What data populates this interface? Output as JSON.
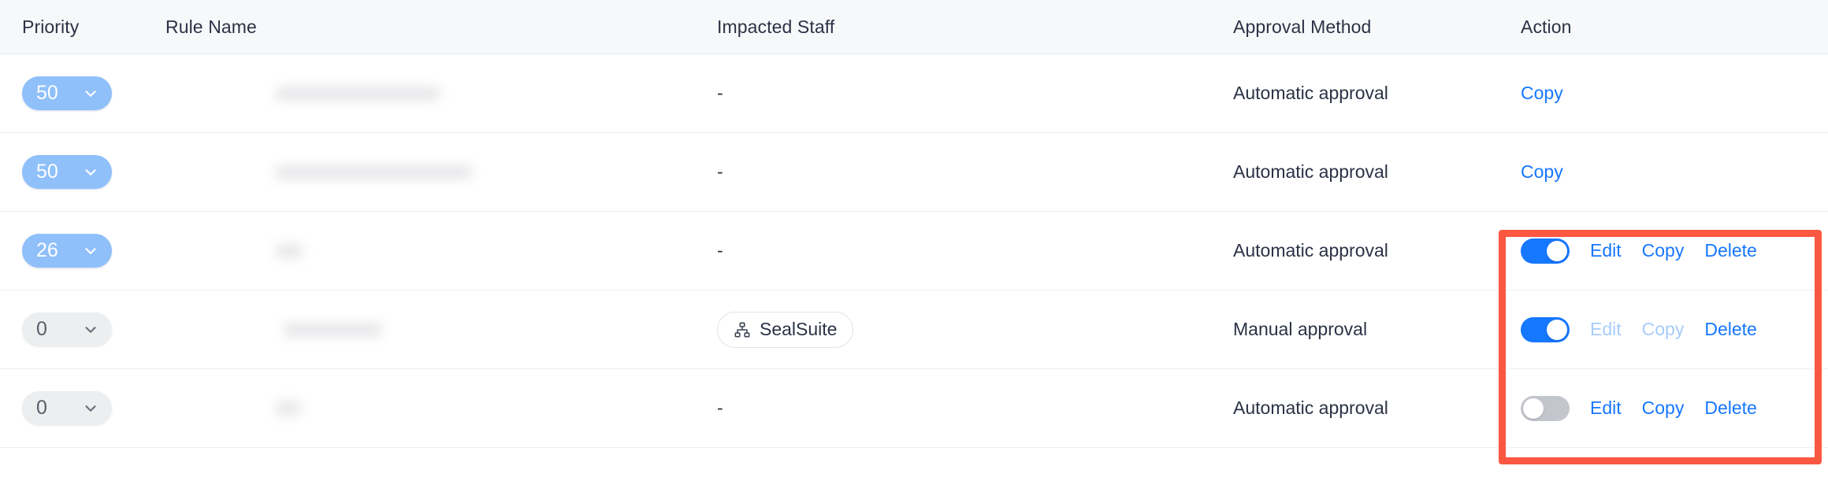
{
  "table": {
    "columns": [
      {
        "key": "priority",
        "label": "Priority"
      },
      {
        "key": "rule_name",
        "label": "Rule Name"
      },
      {
        "key": "impacted_staff",
        "label": "Impacted Staff"
      },
      {
        "key": "approval_method",
        "label": "Approval Method"
      },
      {
        "key": "action",
        "label": "Action"
      }
    ],
    "rows": [
      {
        "priority": "50",
        "rule_name": "",
        "rule_name_redacted": true,
        "impacted_staff": "-",
        "approval_method": "Automatic approval",
        "toggle": null,
        "actions": [
          {
            "label": "Copy",
            "disabled": false
          }
        ]
      },
      {
        "priority": "50",
        "rule_name": "",
        "rule_name_redacted": true,
        "impacted_staff": "-",
        "approval_method": "Automatic approval",
        "toggle": null,
        "actions": [
          {
            "label": "Copy",
            "disabled": false
          }
        ]
      },
      {
        "priority": "26",
        "rule_name": "",
        "rule_name_redacted": true,
        "impacted_staff": "-",
        "approval_method": "Automatic approval",
        "toggle": "on",
        "actions": [
          {
            "label": "Edit",
            "disabled": false
          },
          {
            "label": "Copy",
            "disabled": false
          },
          {
            "label": "Delete",
            "disabled": false
          }
        ]
      },
      {
        "priority": "0",
        "rule_name": "",
        "rule_name_redacted": true,
        "impacted_staff": "SealSuite",
        "impacted_staff_tag": true,
        "approval_method": "Manual approval",
        "toggle": "on",
        "actions": [
          {
            "label": "Edit",
            "disabled": true
          },
          {
            "label": "Copy",
            "disabled": true
          },
          {
            "label": "Delete",
            "disabled": false
          }
        ]
      },
      {
        "priority": "0",
        "rule_name": "",
        "rule_name_redacted": true,
        "impacted_staff": "-",
        "approval_method": "Automatic approval",
        "toggle": "off",
        "actions": [
          {
            "label": "Edit",
            "disabled": false
          },
          {
            "label": "Copy",
            "disabled": false
          },
          {
            "label": "Delete",
            "disabled": false
          }
        ]
      }
    ]
  },
  "icons": {
    "priority_chevron": "chevron-down-icon",
    "staff_tag": "org-chart-icon"
  },
  "annotation": {
    "type": "highlight-rectangle",
    "color": "#fb5741"
  },
  "colors": {
    "link": "#1677ff",
    "link_disabled": "#a7ccfb",
    "toggle_on": "#1677ff",
    "toggle_off": "#c3c6cc",
    "priority_active_bg": "#8fc0fa",
    "priority_zero_bg": "#eceef0",
    "header_bg": "#f7f8fa",
    "text": "#2b3245",
    "annotation": "#fb5741"
  }
}
